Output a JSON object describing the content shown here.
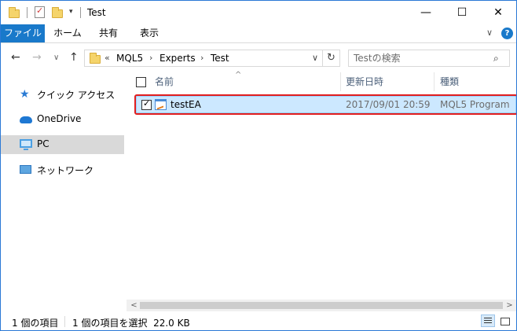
{
  "window": {
    "title": "Test",
    "icons": [
      "folder-icon",
      "properties-icon",
      "new-folder-icon",
      "dropdown-icon"
    ],
    "controls": {
      "minimize": "—",
      "maximize": "☐",
      "close": "✕"
    }
  },
  "ribbon": {
    "tabs": [
      {
        "label": "ファイル"
      },
      {
        "label": "ホーム"
      },
      {
        "label": "共有"
      },
      {
        "label": "表示"
      }
    ],
    "expand_icon": "∨",
    "help_icon": "?"
  },
  "navigation": {
    "back": "←",
    "forward": "→",
    "recent": "∨",
    "up": "↑",
    "breadcrumb": {
      "overflow": "«",
      "parts": [
        "MQL5",
        "Experts",
        "Test"
      ],
      "separator": "›"
    },
    "address_dropdown": "∨",
    "refresh": "↻",
    "search": {
      "placeholder": "Testの検索",
      "icon": "⌕"
    }
  },
  "nav_pane": {
    "items": [
      {
        "label": "クイック アクセス",
        "icon": "star-icon",
        "selected": false
      },
      {
        "label": "OneDrive",
        "icon": "cloud-icon",
        "selected": false
      },
      {
        "label": "PC",
        "icon": "pc-icon",
        "selected": true
      },
      {
        "label": "ネットワーク",
        "icon": "network-icon",
        "selected": false
      }
    ]
  },
  "file_list": {
    "columns": [
      "名前",
      "更新日時",
      "種類"
    ],
    "sort_indicator": "^",
    "rows": [
      {
        "name": "testEA",
        "modified": "2017/09/01 20:59",
        "type": "MQL5 Program",
        "checked": true,
        "selected": true
      }
    ]
  },
  "scrollbar": {
    "left": "<",
    "right": ">"
  },
  "status_bar": {
    "item_count": "1 個の項目",
    "selection": "1 個の項目を選択  22.0 KB"
  },
  "colors": {
    "accent": "#1979ca",
    "selection_bg": "#cce8ff",
    "highlight_border": "#e21e1e"
  }
}
